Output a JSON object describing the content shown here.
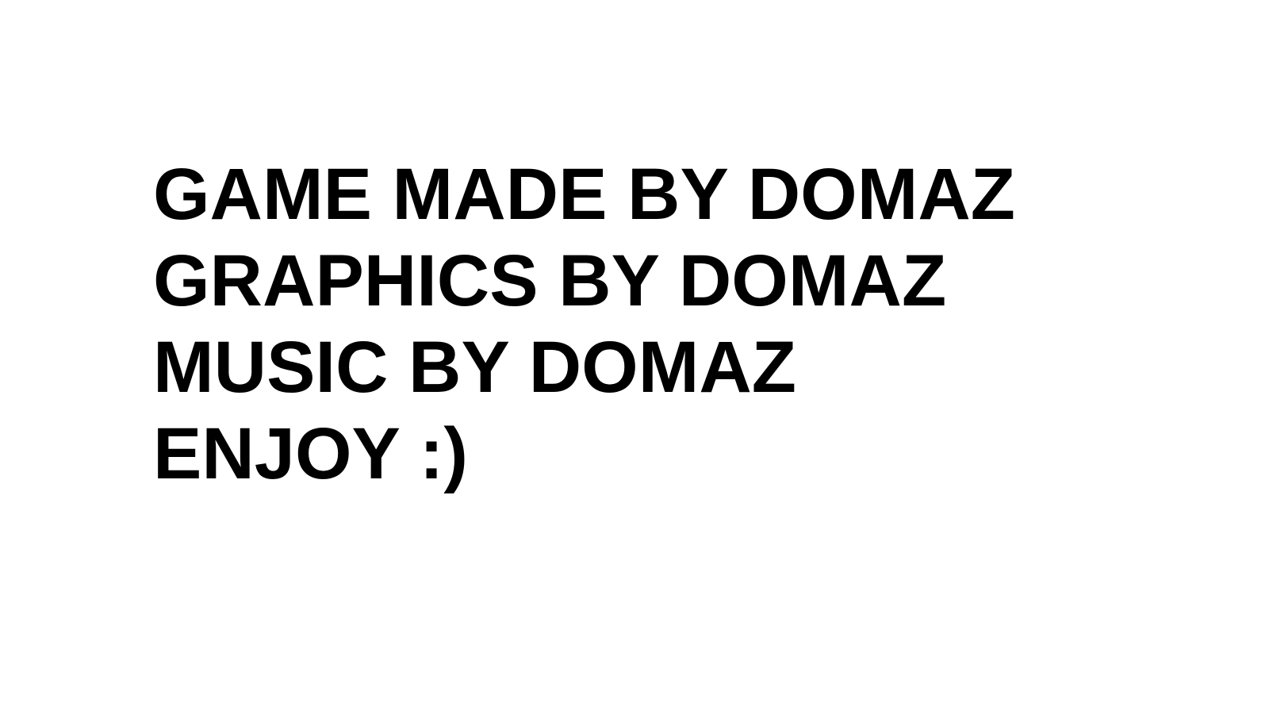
{
  "credits": {
    "lines": [
      "GAME MADE BY DOMAZ",
      "GRAPHICS BY DOMAZ",
      "MUSIC BY DOMAZ",
      "ENJOY :)"
    ]
  },
  "colors": {
    "background": "#ffffff",
    "text": "#000000"
  }
}
